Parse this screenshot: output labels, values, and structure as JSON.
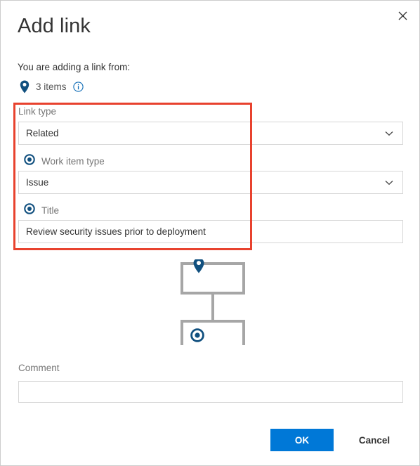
{
  "dialog": {
    "title": "Add link",
    "close_icon": "close-icon",
    "intro_text": "You are adding a link from:",
    "source": {
      "pin_icon": "map-pin-icon",
      "count_label": "3 items",
      "info_icon": "info-circle-icon"
    }
  },
  "form": {
    "link_type": {
      "label": "Link type",
      "value": "Related",
      "chevron_icon": "chevron-down-icon"
    },
    "work_item_type": {
      "radio_icon": "radio-selected-icon",
      "label": "Work item type",
      "value": "Issue",
      "chevron_icon": "chevron-down-icon"
    },
    "title_field": {
      "radio_icon": "radio-selected-icon",
      "label": "Title",
      "value": "Review security issues prior to deployment",
      "placeholder": ""
    },
    "comment": {
      "label": "Comment",
      "value": "",
      "placeholder": ""
    }
  },
  "diagram": {
    "parent_node_icon": "map-pin-icon",
    "child_node_icon": "radio-selected-icon"
  },
  "footer": {
    "ok_label": "OK",
    "cancel_label": "Cancel"
  },
  "colors": {
    "accent_blue": "#0078d7",
    "icon_navy": "#11507f",
    "highlight_red": "#e8422e",
    "border_gray": "#d6d6d6",
    "label_gray": "#767676",
    "diagram_gray": "#a6a6a6"
  }
}
